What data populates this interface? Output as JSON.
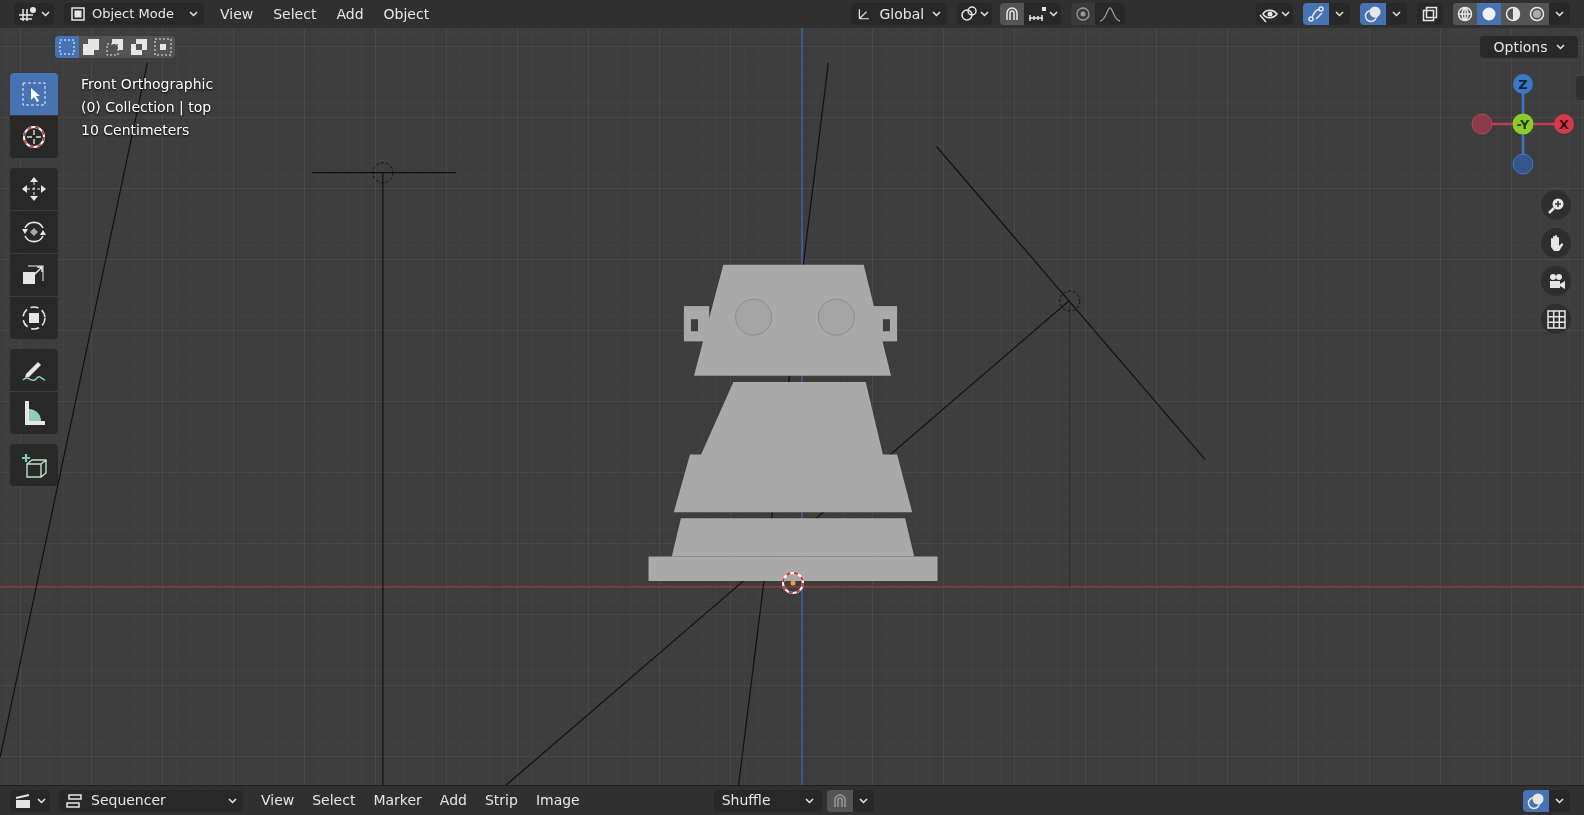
{
  "header": {
    "mode": "Object Mode",
    "menus": [
      "View",
      "Select",
      "Add",
      "Object"
    ],
    "orientation": "Global",
    "gizmos_on": true,
    "overlays_on": true,
    "xray_on": false,
    "shading": [
      {
        "kind": "wireframe",
        "selected": false
      },
      {
        "kind": "solid",
        "selected": true
      },
      {
        "kind": "material",
        "selected": false
      },
      {
        "kind": "rendered",
        "selected": false
      }
    ]
  },
  "select_modes": [
    {
      "kind": "set",
      "selected": true
    },
    {
      "kind": "extend",
      "selected": false
    },
    {
      "kind": "subtract",
      "selected": false
    },
    {
      "kind": "invert",
      "selected": false
    },
    {
      "kind": "intersect",
      "selected": false
    }
  ],
  "options": "Options",
  "tool_groups": [
    [
      {
        "kind": "select",
        "selected": true
      },
      {
        "kind": "cursor",
        "selected": false
      }
    ],
    [
      {
        "kind": "move",
        "selected": false
      },
      {
        "kind": "rotate",
        "selected": false
      },
      {
        "kind": "scale",
        "selected": false
      },
      {
        "kind": "transform",
        "selected": false
      }
    ],
    [
      {
        "kind": "annotate",
        "selected": false
      },
      {
        "kind": "measure",
        "selected": false
      }
    ],
    [
      {
        "kind": "add-cube",
        "selected": false
      }
    ]
  ],
  "viewport": {
    "info": [
      "Front Orthographic",
      "(0) Collection | top",
      "10 Centimeters"
    ],
    "gizmo": {
      "z": "Z",
      "y": "-Y",
      "x": "X"
    }
  },
  "sequencer_header": {
    "editor": "Sequencer",
    "menus": [
      "View",
      "Select",
      "Marker",
      "Add",
      "Strip",
      "Image"
    ],
    "pivot": "Shuffle",
    "overlays_on": true
  }
}
